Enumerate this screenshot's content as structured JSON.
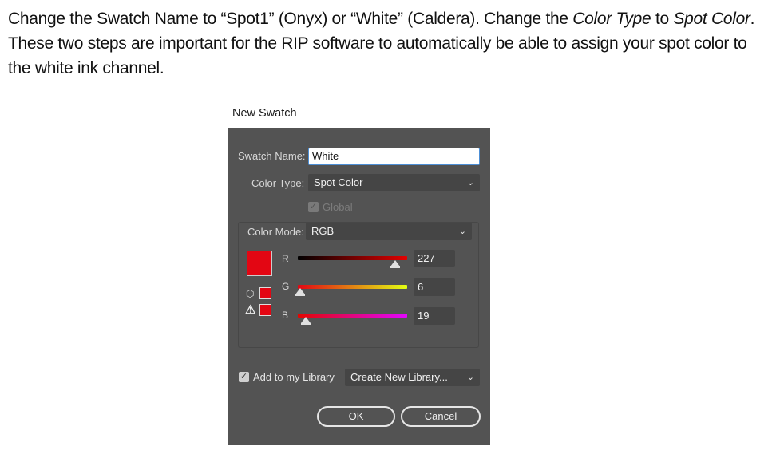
{
  "instructions": {
    "l1_a": "Change the Swatch Name to “Spot1” (Onyx) or “White” (Caldera). Change the ",
    "l1_italic1": "Color Type",
    "l1_b": " to ",
    "l1_italic2": "Spot Color",
    "l1_c": ".",
    "l2": "These two steps are important for the RIP software to automatically be able to assign your spot color to",
    "l3": "the white ink channel."
  },
  "dialog": {
    "title": "New Swatch",
    "swatch_name_label": "Swatch Name:",
    "swatch_name_value": "White",
    "color_type_label": "Color Type:",
    "color_type_value": "Spot Color",
    "global_label": "Global",
    "global_checked": true,
    "color_mode_label": "Color Mode:",
    "color_mode_value": "RGB",
    "swatch_color": "#e30613",
    "channels": [
      {
        "label": "R",
        "value": "227",
        "fraction": 0.89
      },
      {
        "label": "G",
        "value": "6",
        "fraction": 0.02
      },
      {
        "label": "B",
        "value": "19",
        "fraction": 0.07
      }
    ],
    "add_to_library_label": "Add to my Library",
    "add_to_library_checked": true,
    "library_value": "Create New Library...",
    "ok_label": "OK",
    "cancel_label": "Cancel"
  },
  "icons": {
    "dropdown": "chevron-down-icon",
    "gamut_cube": "cube-icon",
    "gamut_warning": "warning-icon"
  }
}
